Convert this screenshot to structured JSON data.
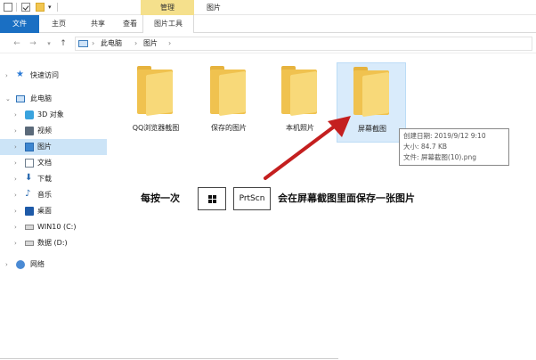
{
  "titlebar": {
    "manage_tab": "管理",
    "title": "图片"
  },
  "ribbon": {
    "tabs": [
      "文件",
      "主页",
      "共享",
      "查看",
      "图片工具"
    ]
  },
  "addressbar": {
    "crumbs": [
      "此电脑",
      "图片"
    ]
  },
  "sidebar": {
    "items": [
      {
        "label": "快速访问",
        "icon": "star-icon"
      },
      {
        "label": "此电脑",
        "icon": "computer-icon"
      },
      {
        "label": "3D 对象",
        "icon": "3d-objects-icon"
      },
      {
        "label": "视频",
        "icon": "video-icon"
      },
      {
        "label": "图片",
        "icon": "pictures-icon"
      },
      {
        "label": "文档",
        "icon": "documents-icon"
      },
      {
        "label": "下载",
        "icon": "download-icon"
      },
      {
        "label": "音乐",
        "icon": "music-icon"
      },
      {
        "label": "桌面",
        "icon": "desktop-icon"
      },
      {
        "label": "WIN10 (C:)",
        "icon": "drive-icon"
      },
      {
        "label": "数据 (D:)",
        "icon": "drive-icon"
      },
      {
        "label": "网络",
        "icon": "network-icon"
      }
    ]
  },
  "folders": [
    {
      "label": "QQ浏览器截图"
    },
    {
      "label": "保存的图片"
    },
    {
      "label": "本机照片"
    },
    {
      "label": "屏幕截图"
    }
  ],
  "tooltip": {
    "line1": "创建日期: 2019/9/12 9:10",
    "line2": "大小: 84.7 KB",
    "line3": "文件: 屏幕截图(10).png"
  },
  "instruction": {
    "before": "每按一次",
    "key2": "PrtScn",
    "after": "会在屏幕截图里面保存一张图片"
  },
  "colors": {
    "accent": "#1a6fc3",
    "manage_tab": "#f5e08c",
    "folder": "#f0c24f",
    "selection": "#cce4f7",
    "arrow": "#c41f1f"
  }
}
